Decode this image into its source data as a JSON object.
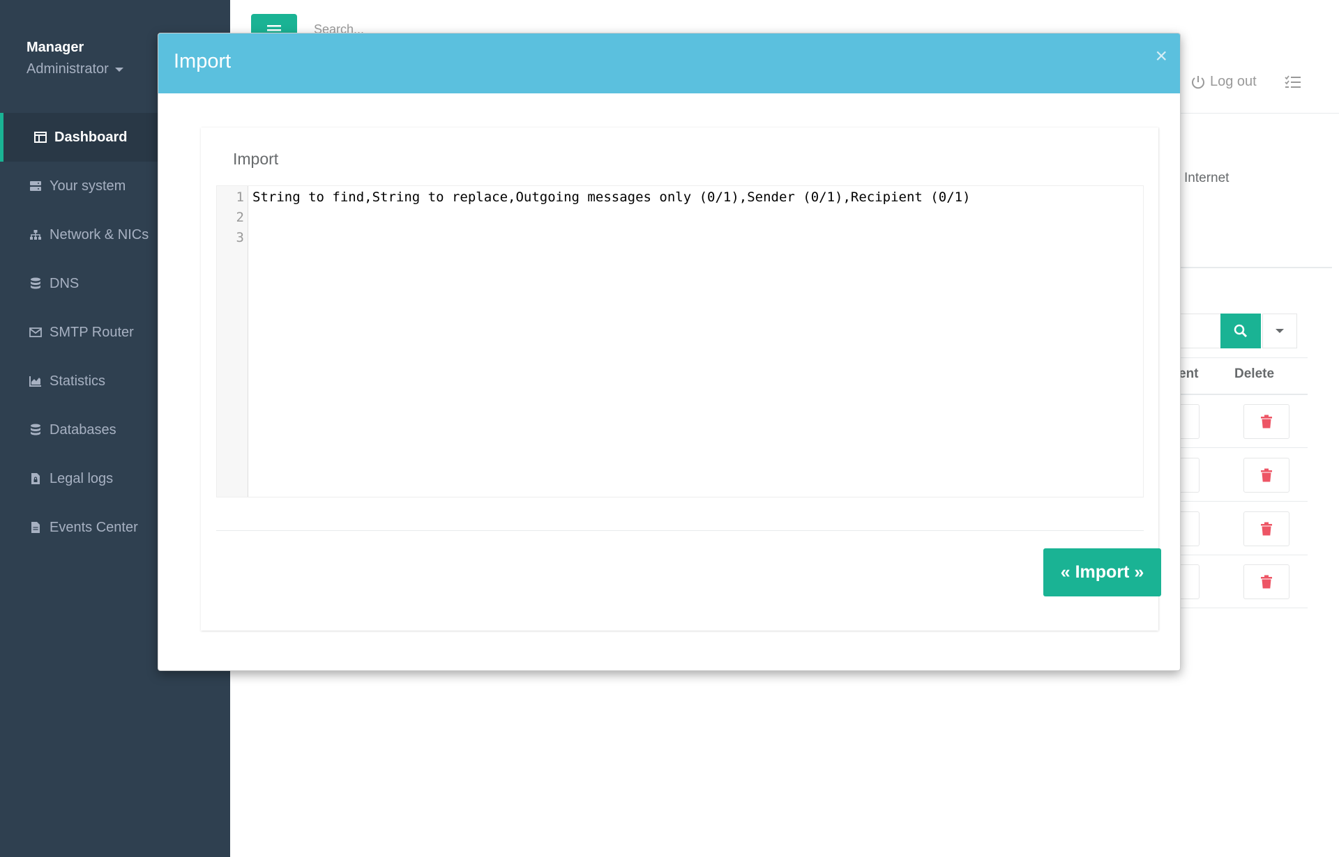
{
  "profile": {
    "name": "Manager",
    "role": "Administrator"
  },
  "nav": [
    {
      "label": "Dashboard",
      "icon": "dashboard-icon",
      "active": true
    },
    {
      "label": "Your system",
      "icon": "server-icon"
    },
    {
      "label": "Network & NICs",
      "icon": "sitemap-icon"
    },
    {
      "label": "DNS",
      "icon": "database-icon"
    },
    {
      "label": "SMTP Router",
      "icon": "envelope-icon"
    },
    {
      "label": "Statistics",
      "icon": "area-chart-icon"
    },
    {
      "label": "Databases",
      "icon": "database-icon"
    },
    {
      "label": "Legal logs",
      "icon": "file-lock-icon"
    },
    {
      "label": "Events Center",
      "icon": "file-text-icon"
    }
  ],
  "topbar": {
    "search_placeholder": "Search...",
    "logout_label": "Log out"
  },
  "background": {
    "internet_label": "Internet",
    "table_headers": [
      "ent",
      "Delete"
    ]
  },
  "modal": {
    "title": "Import",
    "close": "×",
    "panel_label": "Import",
    "editor_lines": [
      "String to find,String to replace,Outgoing messages only (0/1),Sender (0/1),Recipient (0/1)",
      "",
      ""
    ],
    "import_button": "« Import »"
  },
  "colors": {
    "sidebar": "#2f4050",
    "accent": "#1ab394",
    "modal_header": "#5bc0de",
    "danger": "#ed5565"
  }
}
